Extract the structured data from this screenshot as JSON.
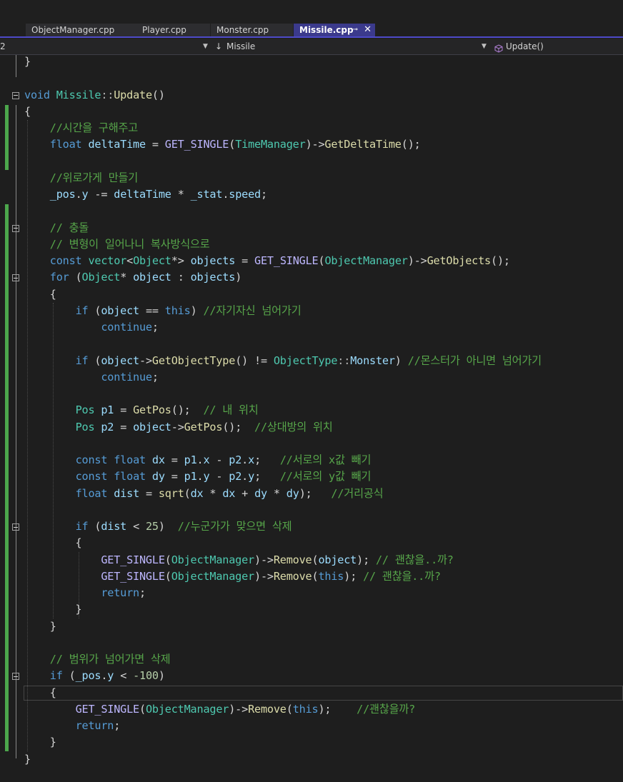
{
  "tabs": [
    {
      "label": "ObjectManager.cpp",
      "active": false
    },
    {
      "label": "Player.cpp",
      "active": false
    },
    {
      "label": "Monster.cpp",
      "active": false
    },
    {
      "label": "Missile.cpp",
      "active": true
    }
  ],
  "tab_pin_glyph": "⊸",
  "tab_close_glyph": "✕",
  "nav": {
    "project_value": "2",
    "class_icon": "down-arrow-icon",
    "class_value": "Missile",
    "member_icon": "cube-icon",
    "member_value": "Update()"
  },
  "colors": {
    "keyword": "#569cd6",
    "type": "#4ec9b0",
    "function": "#dcdcaa",
    "comment": "#57a64a",
    "accent_tab": "#3b3a8c",
    "change_bar": "#4ca64c"
  },
  "code": [
    [
      [
        "p",
        "}"
      ]
    ],
    [],
    [
      [
        "kw",
        "void"
      ],
      [
        "p",
        " "
      ],
      [
        "ty",
        "Missile"
      ],
      [
        "op",
        "::"
      ],
      [
        "fn",
        "Update"
      ],
      [
        "p",
        "()"
      ]
    ],
    [
      [
        "p",
        "{"
      ]
    ],
    [
      [
        "p",
        "    "
      ],
      [
        "cm",
        "//시간을 구해주고"
      ]
    ],
    [
      [
        "p",
        "    "
      ],
      [
        "kw",
        "float"
      ],
      [
        "p",
        " "
      ],
      [
        "va",
        "deltaTime"
      ],
      [
        "p",
        " = "
      ],
      [
        "mc",
        "GET_SINGLE"
      ],
      [
        "p",
        "("
      ],
      [
        "ty",
        "TimeManager"
      ],
      [
        "p",
        ")->"
      ],
      [
        "fn",
        "GetDeltaTime"
      ],
      [
        "p",
        "();"
      ]
    ],
    [],
    [
      [
        "p",
        "    "
      ],
      [
        "cm",
        "//위로가게 만들기"
      ]
    ],
    [
      [
        "p",
        "    "
      ],
      [
        "va",
        "_pos"
      ],
      [
        "p",
        "."
      ],
      [
        "va",
        "y"
      ],
      [
        "p",
        " -= "
      ],
      [
        "va",
        "deltaTime"
      ],
      [
        "p",
        " * "
      ],
      [
        "va",
        "_stat"
      ],
      [
        "p",
        "."
      ],
      [
        "va",
        "speed"
      ],
      [
        "p",
        ";"
      ]
    ],
    [],
    [
      [
        "p",
        "    "
      ],
      [
        "cm",
        "// 충돌"
      ]
    ],
    [
      [
        "p",
        "    "
      ],
      [
        "cm",
        "// 변형이 일어나니 복사방식으로"
      ]
    ],
    [
      [
        "p",
        "    "
      ],
      [
        "kw",
        "const"
      ],
      [
        "p",
        " "
      ],
      [
        "ty",
        "vector"
      ],
      [
        "p",
        "<"
      ],
      [
        "ty",
        "Object"
      ],
      [
        "p",
        "*> "
      ],
      [
        "va",
        "objects"
      ],
      [
        "p",
        " = "
      ],
      [
        "mc",
        "GET_SINGLE"
      ],
      [
        "p",
        "("
      ],
      [
        "ty",
        "ObjectManager"
      ],
      [
        "p",
        ")->"
      ],
      [
        "fn",
        "GetObjects"
      ],
      [
        "p",
        "();"
      ]
    ],
    [
      [
        "p",
        "    "
      ],
      [
        "kw",
        "for"
      ],
      [
        "p",
        " ("
      ],
      [
        "ty",
        "Object"
      ],
      [
        "p",
        "* "
      ],
      [
        "va",
        "object"
      ],
      [
        "p",
        " : "
      ],
      [
        "va",
        "objects"
      ],
      [
        "p",
        ")"
      ]
    ],
    [
      [
        "p",
        "    {"
      ]
    ],
    [
      [
        "p",
        "        "
      ],
      [
        "kw",
        "if"
      ],
      [
        "p",
        " ("
      ],
      [
        "va",
        "object"
      ],
      [
        "p",
        " == "
      ],
      [
        "kw",
        "this"
      ],
      [
        "p",
        ") "
      ],
      [
        "cm",
        "//자기자신 넘어가기"
      ]
    ],
    [
      [
        "p",
        "            "
      ],
      [
        "kw",
        "continue"
      ],
      [
        "p",
        ";"
      ]
    ],
    [],
    [
      [
        "p",
        "        "
      ],
      [
        "kw",
        "if"
      ],
      [
        "p",
        " ("
      ],
      [
        "va",
        "object"
      ],
      [
        "p",
        "->"
      ],
      [
        "fn",
        "GetObjectType"
      ],
      [
        "p",
        "() != "
      ],
      [
        "ty",
        "ObjectType"
      ],
      [
        "op",
        "::"
      ],
      [
        "va",
        "Monster"
      ],
      [
        "p",
        ") "
      ],
      [
        "cm",
        "//몬스터가 아니면 넘어가기"
      ]
    ],
    [
      [
        "p",
        "            "
      ],
      [
        "kw",
        "continue"
      ],
      [
        "p",
        ";"
      ]
    ],
    [],
    [
      [
        "p",
        "        "
      ],
      [
        "ty",
        "Pos"
      ],
      [
        "p",
        " "
      ],
      [
        "va",
        "p1"
      ],
      [
        "p",
        " = "
      ],
      [
        "fn",
        "GetPos"
      ],
      [
        "p",
        "();  "
      ],
      [
        "cm",
        "// 내 위치"
      ]
    ],
    [
      [
        "p",
        "        "
      ],
      [
        "ty",
        "Pos"
      ],
      [
        "p",
        " "
      ],
      [
        "va",
        "p2"
      ],
      [
        "p",
        " = "
      ],
      [
        "va",
        "object"
      ],
      [
        "p",
        "->"
      ],
      [
        "fn",
        "GetPos"
      ],
      [
        "p",
        "();  "
      ],
      [
        "cm",
        "//상대방의 위치"
      ]
    ],
    [],
    [
      [
        "p",
        "        "
      ],
      [
        "kw",
        "const"
      ],
      [
        "p",
        " "
      ],
      [
        "kw",
        "float"
      ],
      [
        "p",
        " "
      ],
      [
        "va",
        "dx"
      ],
      [
        "p",
        " = "
      ],
      [
        "va",
        "p1"
      ],
      [
        "p",
        "."
      ],
      [
        "va",
        "x"
      ],
      [
        "p",
        " - "
      ],
      [
        "va",
        "p2"
      ],
      [
        "p",
        "."
      ],
      [
        "va",
        "x"
      ],
      [
        "p",
        ";   "
      ],
      [
        "cm",
        "//서로의 x값 빼기"
      ]
    ],
    [
      [
        "p",
        "        "
      ],
      [
        "kw",
        "const"
      ],
      [
        "p",
        " "
      ],
      [
        "kw",
        "float"
      ],
      [
        "p",
        " "
      ],
      [
        "va",
        "dy"
      ],
      [
        "p",
        " = "
      ],
      [
        "va",
        "p1"
      ],
      [
        "p",
        "."
      ],
      [
        "va",
        "y"
      ],
      [
        "p",
        " - "
      ],
      [
        "va",
        "p2"
      ],
      [
        "p",
        "."
      ],
      [
        "va",
        "y"
      ],
      [
        "p",
        ";   "
      ],
      [
        "cm",
        "//서로의 y값 빼기"
      ]
    ],
    [
      [
        "p",
        "        "
      ],
      [
        "kw",
        "float"
      ],
      [
        "p",
        " "
      ],
      [
        "va",
        "dist"
      ],
      [
        "p",
        " = "
      ],
      [
        "fn",
        "sqrt"
      ],
      [
        "p",
        "("
      ],
      [
        "va",
        "dx"
      ],
      [
        "p",
        " * "
      ],
      [
        "va",
        "dx"
      ],
      [
        "p",
        " + "
      ],
      [
        "va",
        "dy"
      ],
      [
        "p",
        " * "
      ],
      [
        "va",
        "dy"
      ],
      [
        "p",
        ");   "
      ],
      [
        "cm",
        "//거리공식"
      ]
    ],
    [],
    [
      [
        "p",
        "        "
      ],
      [
        "kw",
        "if"
      ],
      [
        "p",
        " ("
      ],
      [
        "va",
        "dist"
      ],
      [
        "p",
        " < "
      ],
      [
        "nu",
        "25"
      ],
      [
        "p",
        ")  "
      ],
      [
        "cm",
        "//누군가가 맞으면 삭제"
      ]
    ],
    [
      [
        "p",
        "        {"
      ]
    ],
    [
      [
        "p",
        "            "
      ],
      [
        "mc",
        "GET_SINGLE"
      ],
      [
        "p",
        "("
      ],
      [
        "ty",
        "ObjectManager"
      ],
      [
        "p",
        ")->"
      ],
      [
        "fn",
        "Remove"
      ],
      [
        "p",
        "("
      ],
      [
        "va",
        "object"
      ],
      [
        "p",
        "); "
      ],
      [
        "cm",
        "// 괜찮을..까?"
      ]
    ],
    [
      [
        "p",
        "            "
      ],
      [
        "mc",
        "GET_SINGLE"
      ],
      [
        "p",
        "("
      ],
      [
        "ty",
        "ObjectManager"
      ],
      [
        "p",
        ")->"
      ],
      [
        "fn",
        "Remove"
      ],
      [
        "p",
        "("
      ],
      [
        "kw",
        "this"
      ],
      [
        "p",
        "); "
      ],
      [
        "cm",
        "// 괜찮을..까?"
      ]
    ],
    [
      [
        "p",
        "            "
      ],
      [
        "kw",
        "return"
      ],
      [
        "p",
        ";"
      ]
    ],
    [
      [
        "p",
        "        }"
      ]
    ],
    [
      [
        "p",
        "    }"
      ]
    ],
    [],
    [
      [
        "p",
        "    "
      ],
      [
        "cm",
        "// 범위가 넘어가면 삭제"
      ]
    ],
    [
      [
        "p",
        "    "
      ],
      [
        "kw",
        "if"
      ],
      [
        "p",
        " ("
      ],
      [
        "va",
        "_pos"
      ],
      [
        "p",
        "."
      ],
      [
        "va",
        "y"
      ],
      [
        "p",
        " < "
      ],
      [
        "nu",
        "-100"
      ],
      [
        "p",
        ")"
      ]
    ],
    [
      [
        "p",
        "    {"
      ]
    ],
    [
      [
        "p",
        "        "
      ],
      [
        "mc",
        "GET_SINGLE"
      ],
      [
        "p",
        "("
      ],
      [
        "ty",
        "ObjectManager"
      ],
      [
        "p",
        ")->"
      ],
      [
        "fn",
        "Remove"
      ],
      [
        "p",
        "("
      ],
      [
        "kw",
        "this"
      ],
      [
        "p",
        ");    "
      ],
      [
        "cm",
        "//괜찮을까?"
      ]
    ],
    [
      [
        "p",
        "        "
      ],
      [
        "kw",
        "return"
      ],
      [
        "p",
        ";"
      ]
    ],
    [
      [
        "p",
        "    }"
      ]
    ],
    [
      [
        "p",
        "}"
      ]
    ]
  ]
}
